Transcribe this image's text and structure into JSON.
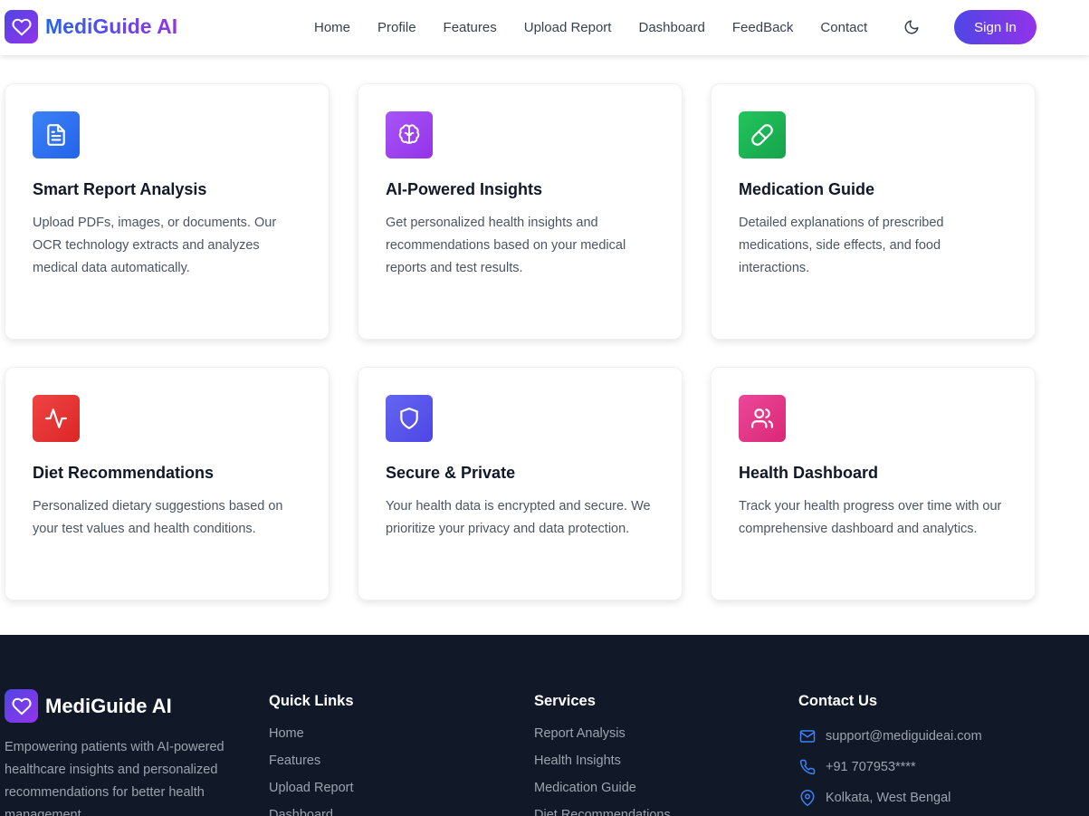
{
  "brand": {
    "name": "MediGuide AI"
  },
  "nav": {
    "items": [
      "Home",
      "Profile",
      "Features",
      "Upload Report",
      "Dashboard",
      "FeedBack",
      "Contact"
    ],
    "theme_icon": "moon-icon",
    "signin_label": "Sign In"
  },
  "features": [
    {
      "title": "Smart Report Analysis",
      "desc": "Upload PDFs, images, or documents. Our OCR technology extracts and analyzes medical data automatically.",
      "icon": "document-icon",
      "color": "#2563eb"
    },
    {
      "title": "AI-Powered Insights",
      "desc": "Get personalized health insights and recommendations based on your medical reports and test results.",
      "icon": "brain-icon",
      "color": "#9333ea"
    },
    {
      "title": "Medication Guide",
      "desc": "Detailed explanations of prescribed medications, side effects, and food interactions.",
      "icon": "pill-icon",
      "color": "#16a34a"
    },
    {
      "title": "Diet Recommendations",
      "desc": "Personalized dietary suggestions based on your test values and health conditions.",
      "icon": "activity-icon",
      "color": "#dc2626"
    },
    {
      "title": "Secure & Private",
      "desc": "Your health data is encrypted and secure. We prioritize your privacy and data protection.",
      "icon": "shield-icon",
      "color": "#4f46e5"
    },
    {
      "title": "Health Dashboard",
      "desc": "Track your health progress over time with our comprehensive dashboard and analytics.",
      "icon": "users-icon",
      "color": "#db2777"
    }
  ],
  "footer": {
    "brand": "MediGuide AI",
    "description": "Empowering patients with AI-powered healthcare insights and personalized recommendations for better health management.",
    "quick_links": {
      "title": "Quick Links",
      "items": [
        "Home",
        "Features",
        "Upload Report",
        "Dashboard"
      ]
    },
    "services": {
      "title": "Services",
      "items": [
        "Report Analysis",
        "Health Insights",
        "Medication Guide",
        "Diet Recommendations"
      ]
    },
    "contact": {
      "title": "Contact Us",
      "email": "support@mediguideai.com",
      "phone": "+91 707953****",
      "location": "Kolkata, West Bengal"
    }
  }
}
